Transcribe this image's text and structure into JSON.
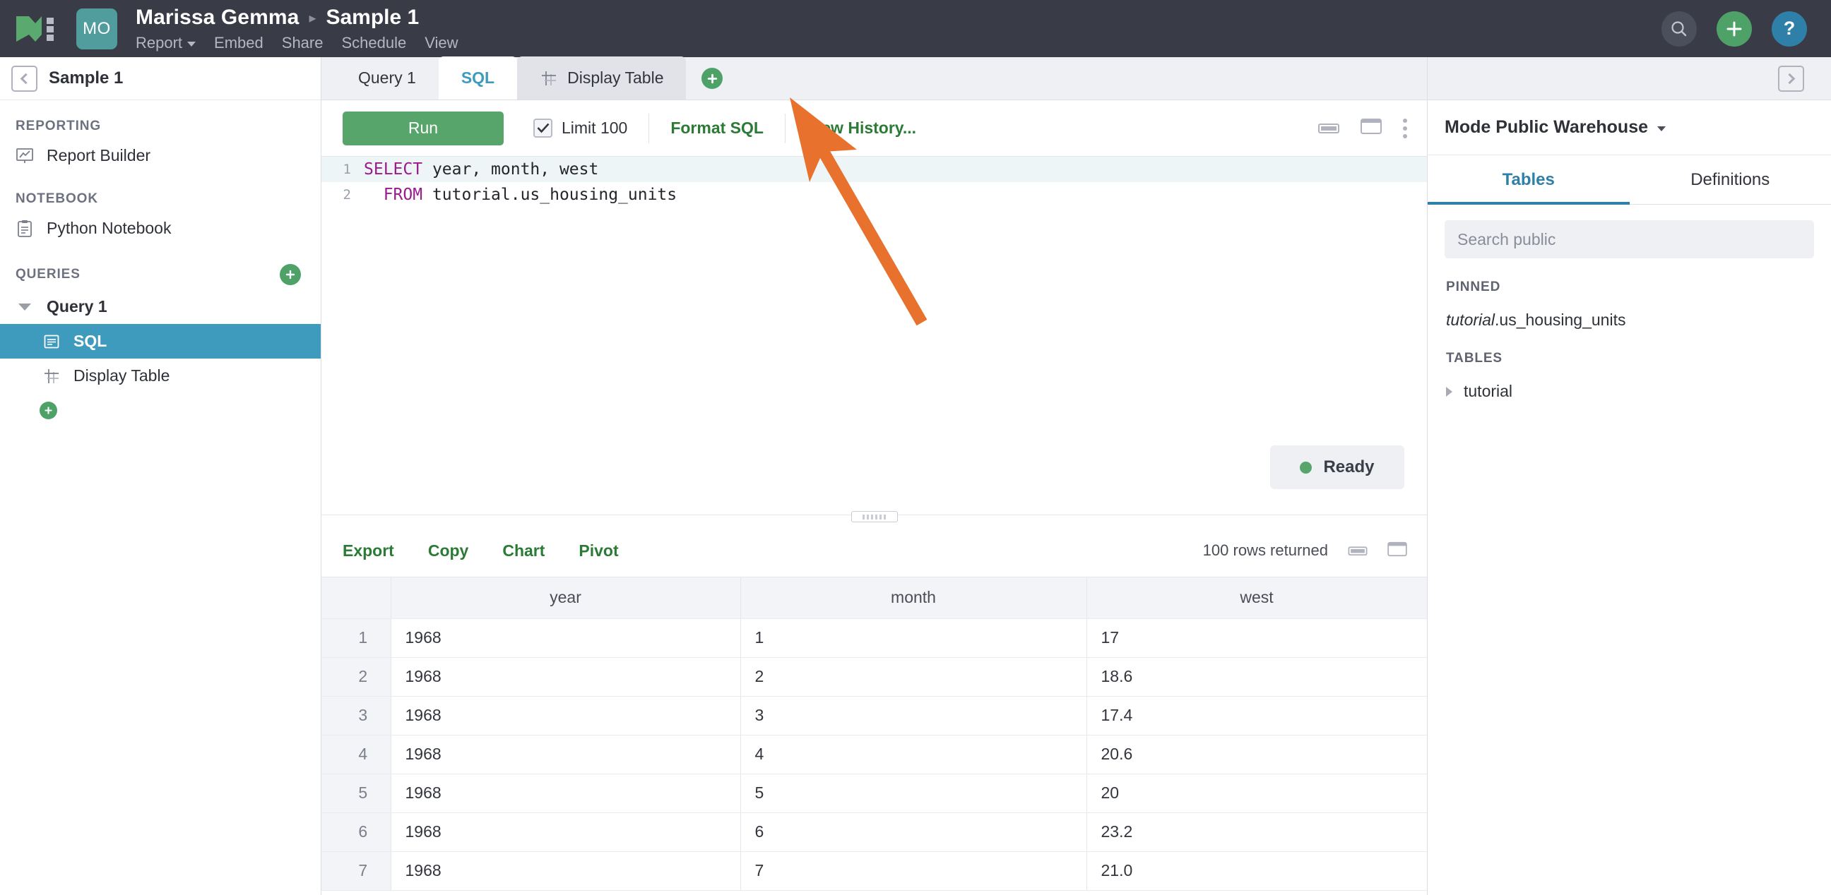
{
  "topbar": {
    "logo": "mode-logo",
    "avatar_initials": "MO",
    "owner_name": "Marissa Gemma",
    "breadcrumb_separator": "▸",
    "doc_name": "Sample 1",
    "subnav": [
      {
        "label": "Report",
        "has_caret": true
      },
      {
        "label": "Embed",
        "has_caret": false
      },
      {
        "label": "Share",
        "has_caret": false
      },
      {
        "label": "Schedule",
        "has_caret": false
      },
      {
        "label": "View",
        "has_caret": false
      }
    ],
    "actions": [
      {
        "name": "search-icon",
        "label": ""
      },
      {
        "name": "add-icon",
        "label": ""
      },
      {
        "name": "help-icon",
        "label": "?"
      }
    ]
  },
  "sidebar": {
    "header_title": "Sample 1",
    "collapse_icon": "chevron-left-icon",
    "sections": [
      {
        "label": "REPORTING",
        "add_button": false
      },
      {
        "label": "NOTEBOOK",
        "add_button": false
      },
      {
        "label": "QUERIES",
        "add_button": true
      }
    ],
    "reporting_items": [
      {
        "label": "Report Builder",
        "icon": "report-builder-icon"
      }
    ],
    "notebook_items": [
      {
        "label": "Python Notebook",
        "icon": "notebook-icon"
      }
    ],
    "query_group": {
      "label": "Query 1",
      "expanded": true,
      "children": [
        {
          "label": "SQL",
          "icon": "sql-icon",
          "active": true
        },
        {
          "label": "Display Table",
          "icon": "table-icon",
          "active": false
        }
      ]
    }
  },
  "tabs": [
    {
      "label": "Query 1",
      "state": "plain",
      "icon": null
    },
    {
      "label": "SQL",
      "state": "active",
      "icon": null
    },
    {
      "label": "Display Table",
      "state": "shaded",
      "icon": "table-icon"
    }
  ],
  "tab_add_button": "add-tab-button",
  "sql_toolbar": {
    "run_label": "Run",
    "limit_label": "Limit 100",
    "limit_checked": true,
    "format_label": "Format SQL",
    "history_label": "View History...",
    "pane_icons": [
      "collapse-pane-icon",
      "expand-pane-icon",
      "more-options-icon"
    ]
  },
  "editor": {
    "lines": [
      {
        "number": "1",
        "keyword": "SELECT",
        "rest": " year, month, west",
        "highlighted": true
      },
      {
        "number": "2",
        "keyword": "FROM",
        "rest": " tutorial.us_housing_units",
        "indent": "  ",
        "highlighted": false
      }
    ],
    "status_label": "Ready",
    "status_color": "#58a56c"
  },
  "results_toolbar": {
    "links": [
      "Export",
      "Copy",
      "Chart",
      "Pivot"
    ],
    "rows_returned": "100 rows returned",
    "pane_icons": [
      "collapse-pane-icon",
      "expand-pane-icon"
    ]
  },
  "results_table": {
    "index_header": "",
    "columns": [
      "year",
      "month",
      "west"
    ],
    "rows": [
      {
        "index": "1",
        "cells": [
          "1968",
          "1",
          "17"
        ]
      },
      {
        "index": "2",
        "cells": [
          "1968",
          "2",
          "18.6"
        ]
      },
      {
        "index": "3",
        "cells": [
          "1968",
          "3",
          "17.4"
        ]
      },
      {
        "index": "4",
        "cells": [
          "1968",
          "4",
          "20.6"
        ]
      },
      {
        "index": "5",
        "cells": [
          "1968",
          "5",
          "20"
        ]
      },
      {
        "index": "6",
        "cells": [
          "1968",
          "6",
          "23.2"
        ]
      },
      {
        "index": "7",
        "cells": [
          "1968",
          "7",
          "21.0"
        ]
      }
    ]
  },
  "right_panel": {
    "expand_icon": "chevron-right-icon",
    "source_name": "Mode Public Warehouse",
    "source_caret": "caret-down-icon",
    "tabs": [
      {
        "label": "Tables",
        "active": true
      },
      {
        "label": "Definitions",
        "active": false
      }
    ],
    "search_placeholder": "Search public",
    "search_value": "",
    "pinned_label": "PINNED",
    "pinned_items": [
      {
        "schema": "tutorial",
        "table": ".us_housing_units"
      }
    ],
    "tables_label": "TABLES",
    "tree_items": [
      {
        "label": "tutorial",
        "expanded": false
      }
    ]
  },
  "annotation": {
    "type": "arrow",
    "color": "#e8712e",
    "points_to": "add-tab-button"
  },
  "colors": {
    "topbar_bg": "#393b47",
    "accent_green": "#4ea268",
    "accent_blue": "#3f9bbd",
    "link_green": "#2b7a36",
    "avatar_teal": "#519d9e",
    "annotation_orange": "#e8712e"
  }
}
